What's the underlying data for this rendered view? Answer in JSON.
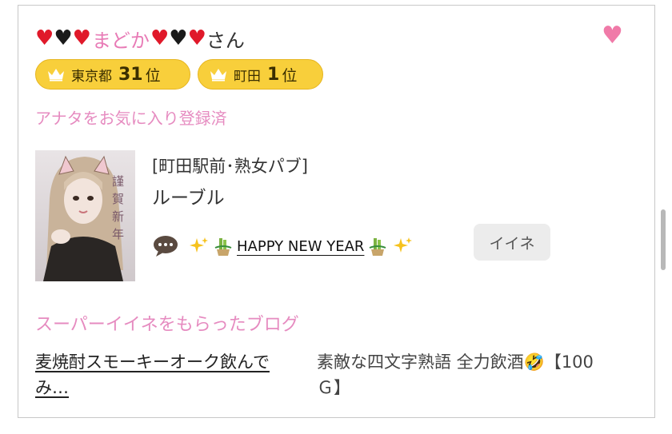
{
  "profile": {
    "name_pre_hearts": [
      "red",
      "black",
      "red"
    ],
    "name": "まどか",
    "name_post_hearts": [
      "red",
      "black",
      "red"
    ],
    "honorific": "さん",
    "favorite_icon": "heart-icon"
  },
  "badges": [
    {
      "area": "東京都",
      "rank": "31",
      "unit": "位"
    },
    {
      "area": "町田",
      "rank": "1",
      "unit": "位"
    }
  ],
  "favorite_status": "アナタをお気に入り登録済",
  "shop": {
    "category": "[町田駅前･熟女パブ]",
    "name": "ルーブル"
  },
  "post": {
    "title": "HAPPY NEW YEAR",
    "like_label": "イイネ"
  },
  "super_like": {
    "section_title": "スーパーイイネをもらったブログ",
    "blog_title": "麦焼酎スモーキーオーク飲んでみ…",
    "blog_description": "素敵な四文字熟語 全力飲酒🤣【100Ｇ】"
  },
  "colors": {
    "accent_pink": "#e68bc0",
    "badge_yellow": "#f8cf3b",
    "heart_red": "#e0192a"
  }
}
